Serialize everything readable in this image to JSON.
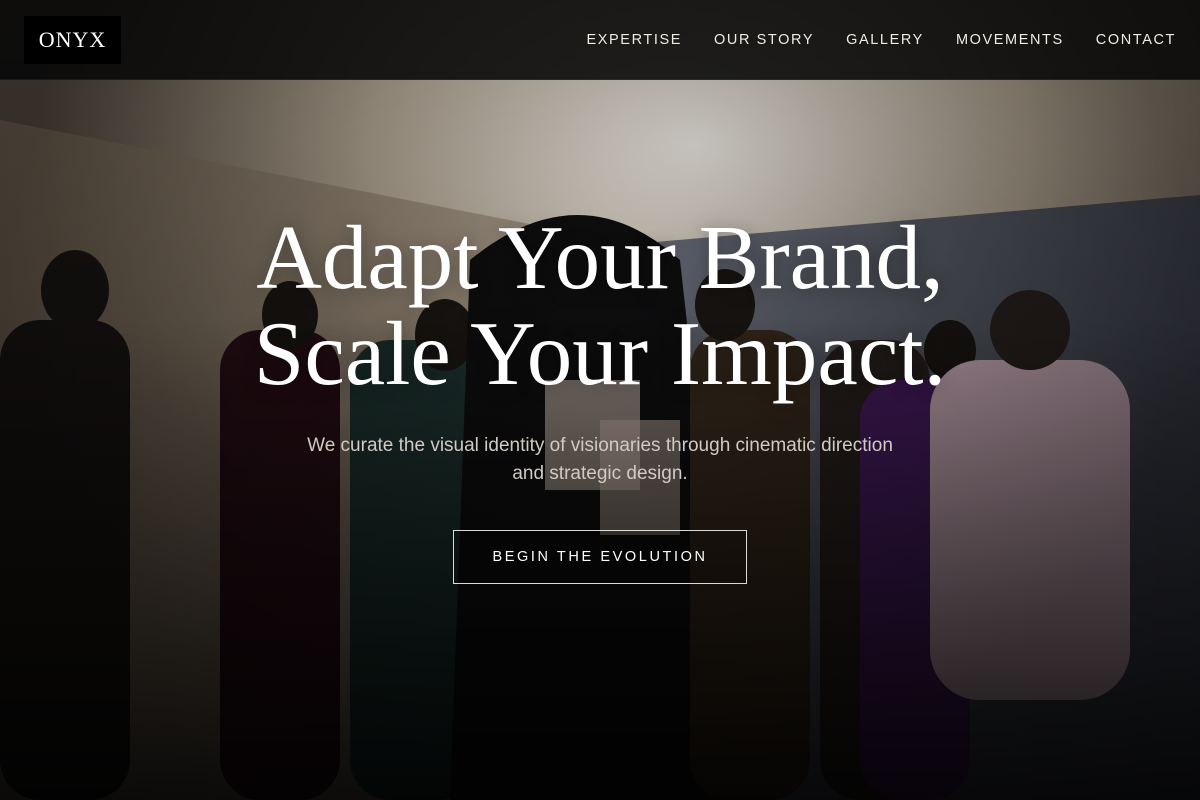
{
  "header": {
    "logo": "ONYX",
    "nav": [
      {
        "label": "EXPERTISE"
      },
      {
        "label": "OUR STORY"
      },
      {
        "label": "GALLERY"
      },
      {
        "label": "MOVEMENTS"
      },
      {
        "label": "CONTACT"
      }
    ]
  },
  "hero": {
    "headline_line1": "Adapt Your Brand,",
    "headline_line2": "Scale Your Impact.",
    "subtitle_line1": "We curate the visual identity of visionaries through cinematic direction",
    "subtitle_line2": "and strategic design.",
    "cta_label": "BEGIN THE EVOLUTION"
  },
  "colors": {
    "header_bg": "#080808",
    "text": "#ffffff",
    "subtitle": "#cfcac4"
  }
}
